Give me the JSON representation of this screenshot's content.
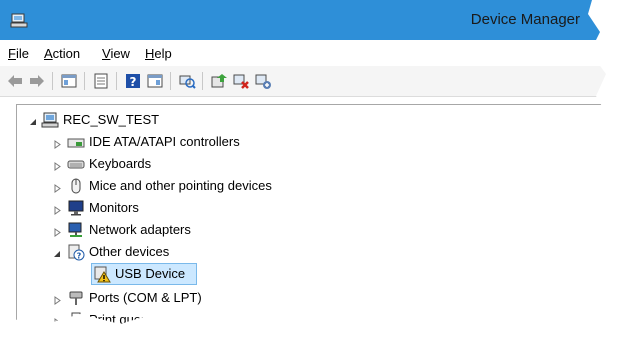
{
  "window": {
    "title": "Device Manager"
  },
  "colors": {
    "title_bar": "#2e8fd8",
    "selection": "#cce8ff",
    "selection_border": "#7ab9ea"
  },
  "menu": {
    "items": [
      {
        "label": "File"
      },
      {
        "label": "Action"
      },
      {
        "label": "View"
      },
      {
        "label": "Help"
      }
    ]
  },
  "toolbar": {
    "icons": [
      "back-arrow-icon",
      "forward-arrow-icon",
      "properties-icon",
      "show-hide-tree-icon",
      "help-icon",
      "action-pane-icon",
      "scan-hardware-icon",
      "update-driver-icon",
      "uninstall-device-icon",
      "disable-device-icon"
    ]
  },
  "tree": {
    "root": {
      "label": "REC_SW_TEST",
      "icon": "computer-icon",
      "expanded": true
    },
    "items": [
      {
        "label": "IDE ATA/ATAPI controllers",
        "icon": "ide-controller-icon",
        "expanded": false
      },
      {
        "label": "Keyboards",
        "icon": "keyboard-icon",
        "expanded": false
      },
      {
        "label": "Mice and other pointing devices",
        "icon": "mouse-icon",
        "expanded": false
      },
      {
        "label": "Monitors",
        "icon": "monitor-icon",
        "expanded": false
      },
      {
        "label": "Network adapters",
        "icon": "network-adapter-icon",
        "expanded": false
      },
      {
        "label": "Other devices",
        "icon": "unknown-device-icon",
        "expanded": true,
        "children": [
          {
            "label": "USB Device",
            "icon": "warning-device-icon",
            "selected": true
          }
        ]
      },
      {
        "label": "Ports (COM & LPT)",
        "icon": "port-icon",
        "expanded": false
      },
      {
        "label": "Print queues",
        "icon": "printer-icon",
        "expanded": false
      }
    ]
  }
}
